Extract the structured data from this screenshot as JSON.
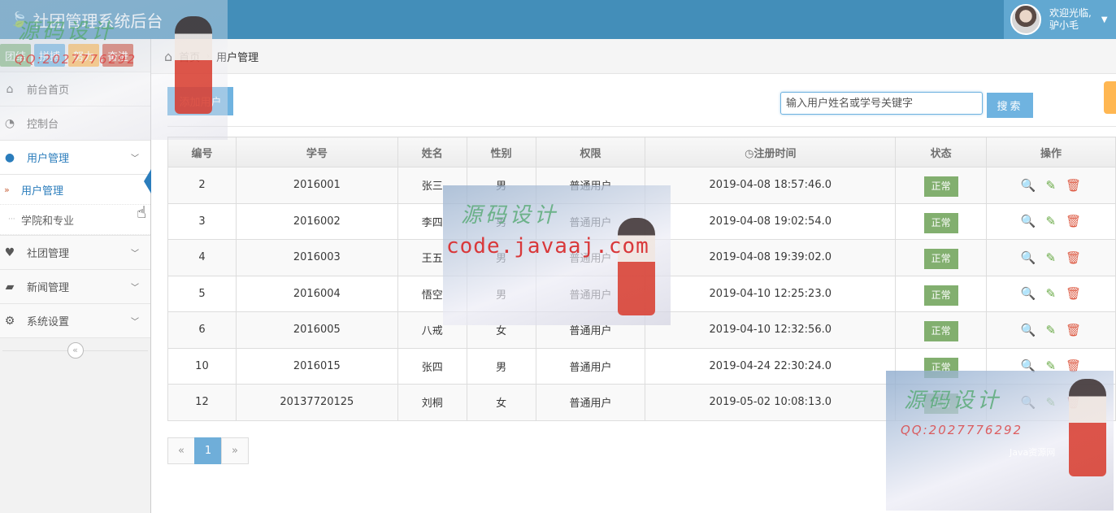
{
  "app": {
    "title": "社团管理系统后台"
  },
  "user": {
    "greeting": "欢迎光临,",
    "name": "驴小毛"
  },
  "shortcuts": [
    {
      "label": "团结",
      "color": "#87b87f"
    },
    {
      "label": "拼搏",
      "color": "#6fb3e0"
    },
    {
      "label": "努力",
      "color": "#ffb752"
    },
    {
      "label": "奋进",
      "color": "#d15b47"
    }
  ],
  "sidebar": {
    "items": [
      {
        "label": "前台首页",
        "icon": "home-icon"
      },
      {
        "label": "控制台",
        "icon": "dashboard-icon"
      },
      {
        "label": "用户管理",
        "icon": "user-icon",
        "open": true
      },
      {
        "label": "社团管理",
        "icon": "heart-icon"
      },
      {
        "label": "新闻管理",
        "icon": "book-icon"
      },
      {
        "label": "系统设置",
        "icon": "gear-icon"
      }
    ],
    "submenu": [
      {
        "label": "用户管理",
        "active": true
      },
      {
        "label": "学院和专业"
      }
    ],
    "collapse_glyph": "«"
  },
  "breadcrumb": {
    "home": "首页",
    "current": "用户管理"
  },
  "toolbar": {
    "add_label": "添加用户",
    "search_placeholder": "输入用户姓名或学号关键字",
    "search_label": "搜索"
  },
  "table": {
    "columns": [
      "编号",
      "学号",
      "姓名",
      "性别",
      "权限",
      "注册时间",
      "状态",
      "操作"
    ],
    "rows": [
      {
        "id": "2",
        "student_no": "2016001",
        "name": "张三",
        "gender": "男",
        "role": "普通用户",
        "registered": "2019-04-08 18:57:46.0",
        "status": "正常"
      },
      {
        "id": "3",
        "student_no": "2016002",
        "name": "李四",
        "gender": "男",
        "role": "普通用户",
        "registered": "2019-04-08 19:02:54.0",
        "status": "正常"
      },
      {
        "id": "4",
        "student_no": "2016003",
        "name": "王五",
        "gender": "男",
        "role": "普通用户",
        "registered": "2019-04-08 19:39:02.0",
        "status": "正常"
      },
      {
        "id": "5",
        "student_no": "2016004",
        "name": "悟空",
        "gender": "男",
        "role": "普通用户",
        "registered": "2019-04-10 12:25:23.0",
        "status": "正常"
      },
      {
        "id": "6",
        "student_no": "2016005",
        "name": "八戒",
        "gender": "女",
        "role": "普通用户",
        "registered": "2019-04-10 12:32:56.0",
        "status": "正常"
      },
      {
        "id": "10",
        "student_no": "2016015",
        "name": "张四",
        "gender": "男",
        "role": "普通用户",
        "registered": "2019-04-24 22:30:24.0",
        "status": "正常"
      },
      {
        "id": "12",
        "student_no": "20137720125",
        "name": "刘桐",
        "gender": "女",
        "role": "普通用户",
        "registered": "2019-05-02 10:08:13.0",
        "status": "正常"
      }
    ]
  },
  "pagination": {
    "prev": "«",
    "current": "1",
    "next": "»"
  },
  "watermark": {
    "script": "源码设计",
    "qq": "QQ:2027776292",
    "url": "code.javaaj.com",
    "site": "Java资源网"
  },
  "colors": {
    "navbar": "#438eb9",
    "primary_button": "#6fb3e0",
    "status_ok": "#82af6f"
  }
}
